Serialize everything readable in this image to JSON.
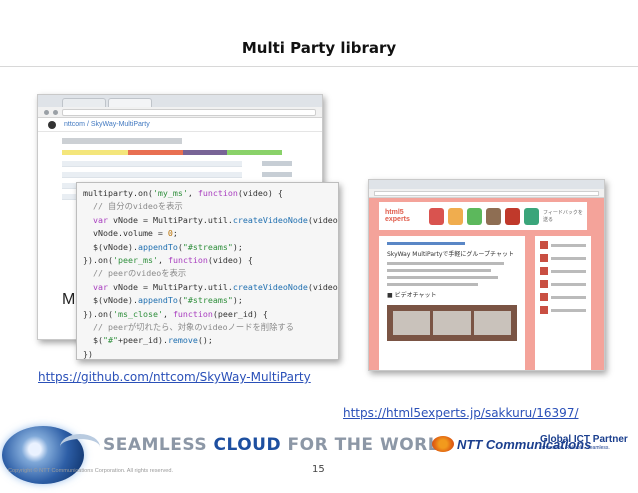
{
  "slide": {
    "title": "Multi Party library",
    "page_number": "15",
    "copyright": "Copyright © NTT Communications Corporation. All rights reserved."
  },
  "github_window": {
    "repo": "nttcom / SkyWay-MultiParty",
    "partial_heading": "M"
  },
  "code": {
    "lines": [
      "multiparty.on('my_ms', function(video) {",
      "  // 自分のvideoを表示",
      "  var vNode = MultiParty.util.createVideoNode(video);",
      "  vNode.volume = 0;",
      "  $(vNode).appendTo(\"#streams\");",
      "}).on('peer_ms', function(video) {",
      "  // peerのvideoを表示",
      "  var vNode = MultiParty.util.createVideoNode(video);",
      "  $(vNode).appendTo(\"#streams\");",
      "}).on('ms_close', function(peer_id) {",
      "  // peerが切れたら、対象のvideoノードを削除する",
      "  $(\"#\"+peer_id).remove();",
      "})"
    ]
  },
  "html5_window": {
    "logo": "html5 experts",
    "header_text": "フィードバックを送る",
    "article_text": "SkyWay MultiPartyで手軽にグループチャット",
    "section_text": "■ ビデオチャット"
  },
  "links": {
    "github": "https://github.com/nttcom/SkyWay-MultiParty",
    "html5experts": "https://html5experts.jp/sakkuru/16397/"
  },
  "footer": {
    "tagline_prefix": "SEAMLESS ",
    "tagline_strong": "CLOUD",
    "tagline_suffix": " FOR THE WORLD",
    "ntt": "NTT Communications",
    "partner_title": "Global ICT Partner",
    "partner_sub": "Innovative. Reliable. Seamless."
  },
  "colors": {
    "link": "#2a50b8",
    "brand_blue": "#1d4fa0",
    "site_pink": "#f4a39a"
  }
}
